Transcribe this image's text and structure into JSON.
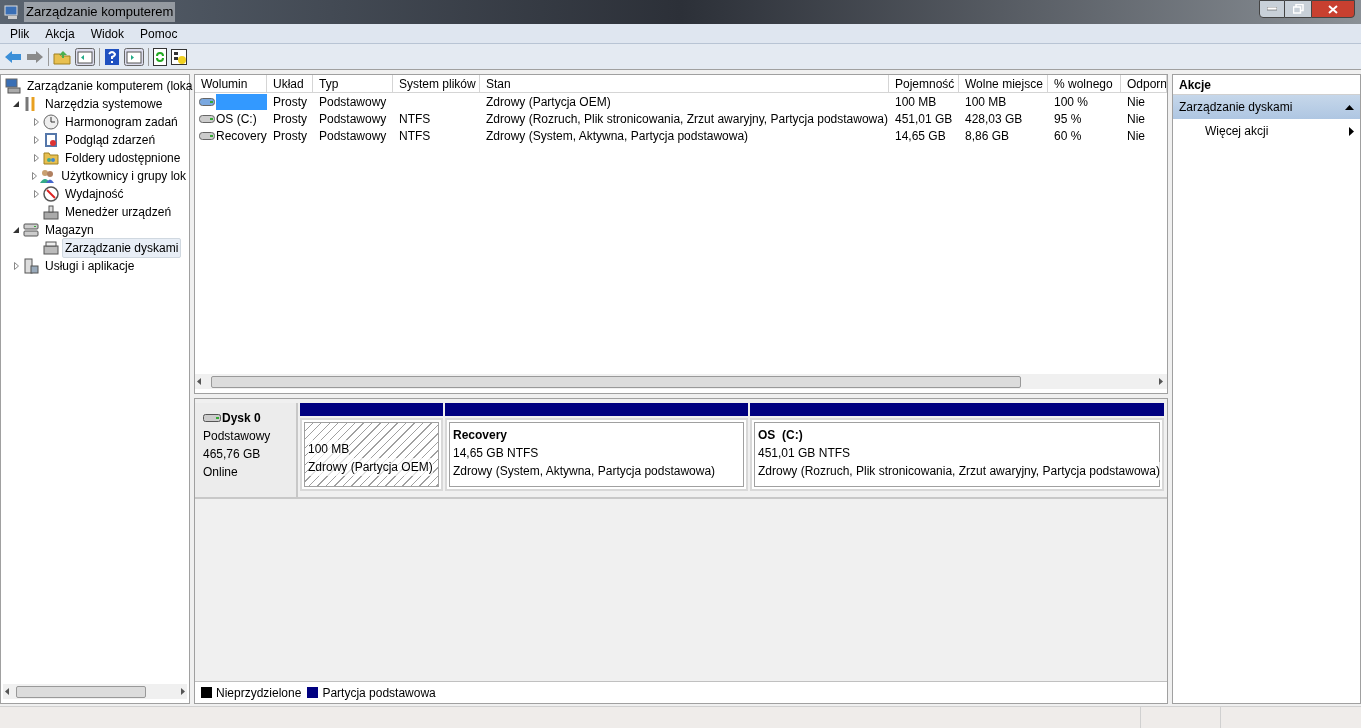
{
  "window": {
    "title": "Zarządzanie komputerem"
  },
  "menu": [
    "Plik",
    "Akcja",
    "Widok",
    "Pomoc"
  ],
  "tree": [
    {
      "label": "Zarządzanie komputerem (loka",
      "selected": false,
      "children": [
        {
          "label": "Narzędzia systemowe",
          "expanded": true,
          "selected": false,
          "children": [
            {
              "label": "Harmonogram zadań",
              "expanded": false,
              "selected": false
            },
            {
              "label": "Podgląd zdarzeń",
              "expanded": false,
              "selected": false
            },
            {
              "label": "Foldery udostępnione",
              "expanded": false,
              "selected": false
            },
            {
              "label": "Użytkownicy i grupy lok",
              "expanded": false,
              "selected": false
            },
            {
              "label": "Wydajność",
              "expanded": false,
              "selected": false
            },
            {
              "label": "Menedżer urządzeń",
              "selected": false
            }
          ]
        },
        {
          "label": "Magazyn",
          "expanded": true,
          "selected": false,
          "children": [
            {
              "label": "Zarządzanie dyskami",
              "selected": true
            }
          ]
        },
        {
          "label": "Usługi i aplikacje",
          "expanded": false,
          "selected": false
        }
      ]
    }
  ],
  "table": {
    "columns": [
      "Wolumin",
      "Układ",
      "Typ",
      "System plików",
      "Stan",
      "Pojemność",
      "Wolne miejsce",
      "% wolnego",
      "Odporn"
    ],
    "rows": [
      {
        "selected": true,
        "cells": [
          "",
          "Prosty",
          "Podstawowy",
          "",
          "Zdrowy (Partycja OEM)",
          "100 MB",
          "100 MB",
          "100 %",
          "Nie"
        ]
      },
      {
        "selected": false,
        "cells": [
          "OS (C:)",
          "Prosty",
          "Podstawowy",
          "NTFS",
          "Zdrowy (Rozruch, Plik stronicowania, Zrzut awaryjny, Partycja podstawowa)",
          "451,01 GB",
          "428,03 GB",
          "95 %",
          "Nie"
        ]
      },
      {
        "selected": false,
        "cells": [
          "Recovery",
          "Prosty",
          "Podstawowy",
          "NTFS",
          "Zdrowy (System, Aktywna, Partycja podstawowa)",
          "14,65 GB",
          "8,86 GB",
          "60 %",
          "Nie"
        ]
      }
    ]
  },
  "disk": {
    "name": "Dysk 0",
    "type": "Podstawowy",
    "size": "465,76 GB",
    "status": "Online",
    "partitions": [
      {
        "selected": true,
        "size": "100 MB",
        "status": "Zdrowy (Partycja OEM)"
      },
      {
        "selected": false,
        "name": "Recovery",
        "size": "14,65 GB NTFS",
        "status": "Zdrowy (System, Aktywna, Partycja podstawowa)"
      },
      {
        "selected": false,
        "name": "OS  (C:)",
        "size": "451,01 GB NTFS",
        "status": "Zdrowy (Rozruch, Plik stronicowania, Zrzut awaryjny, Partycja podstawowa)"
      }
    ]
  },
  "legend": [
    {
      "label": "Nieprzydzielone",
      "color": "#000000"
    },
    {
      "label": "Partycja podstawowa",
      "color": "#000080"
    }
  ],
  "actions": {
    "title": "Akcje",
    "section": "Zarządzanie dyskami",
    "items": [
      "Więcej akcji"
    ]
  }
}
